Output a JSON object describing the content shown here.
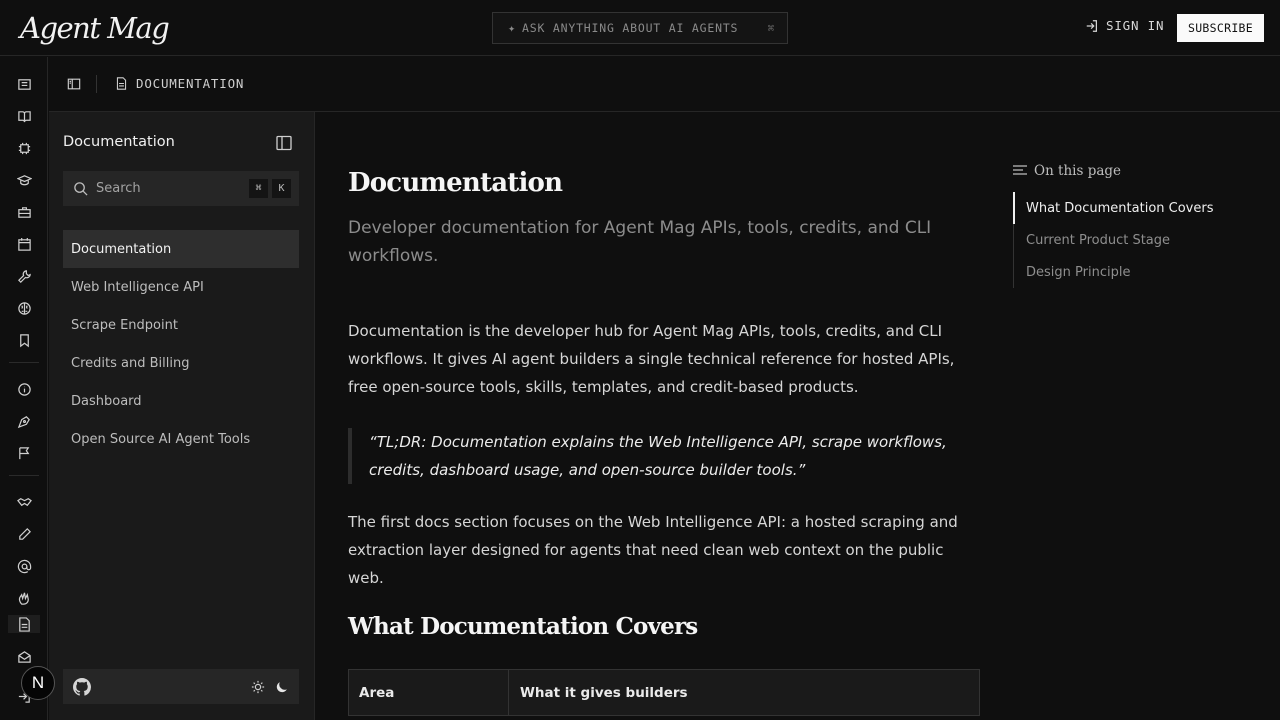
{
  "header": {
    "logo": "Agent Mag",
    "ask_placeholder": "ASK ANYTHING ABOUT AI AGENTS",
    "ask_shortcut": "⌘",
    "sign_in": "SIGN IN",
    "subscribe": "SUBSCRIBE"
  },
  "rail": {
    "icons": [
      "newspaper-icon",
      "book-open-icon",
      "cpu-icon",
      "graduation-cap-icon",
      "briefcase-icon",
      "calendar-icon",
      "wrench-icon",
      "brain-icon",
      "bookmark-icon",
      "info-icon",
      "pen-nib-icon",
      "flag-icon",
      "handshake-icon",
      "pencil-icon",
      "at-sign-icon",
      "waving-hand-icon",
      "file-text-icon",
      "mail-open-icon",
      "log-in-icon"
    ]
  },
  "breadcrumb": {
    "label": "DOCUMENTATION"
  },
  "sidebar": {
    "title": "Documentation",
    "search_placeholder": "Search",
    "kbd": [
      "⌘",
      "K"
    ],
    "items": [
      {
        "label": "Documentation",
        "active": true
      },
      {
        "label": "Web Intelligence API"
      },
      {
        "label": "Scrape Endpoint"
      },
      {
        "label": "Credits and Billing"
      },
      {
        "label": "Dashboard"
      },
      {
        "label": "Open Source AI Agent Tools"
      }
    ]
  },
  "main": {
    "title": "Documentation",
    "subtitle": "Developer documentation for Agent Mag APIs, tools, credits, and CLI workflows.",
    "intro": "Documentation is the developer hub for Agent Mag APIs, tools, credits, and CLI workflows. It gives AI agent builders a single technical reference for hosted APIs, free open-source tools, skills, templates, and credit-based products.",
    "quote": "“TL;DR: Documentation explains the Web Intelligence API, scrape workflows, credits, dashboard usage, and open-source builder tools.”",
    "para2": "The first docs section focuses on the Web Intelligence API: a hosted scraping and extraction layer designed for agents that need clean web context on the public web.",
    "section_title": "What Documentation Covers",
    "table": {
      "headers": [
        "Area",
        "What it gives builders"
      ]
    }
  },
  "toc": {
    "heading": "On this page",
    "items": [
      {
        "label": "What Documentation Covers",
        "active": true
      },
      {
        "label": "Current Product Stage"
      },
      {
        "label": "Design Principle"
      }
    ]
  },
  "badge": {
    "letter": "N"
  }
}
